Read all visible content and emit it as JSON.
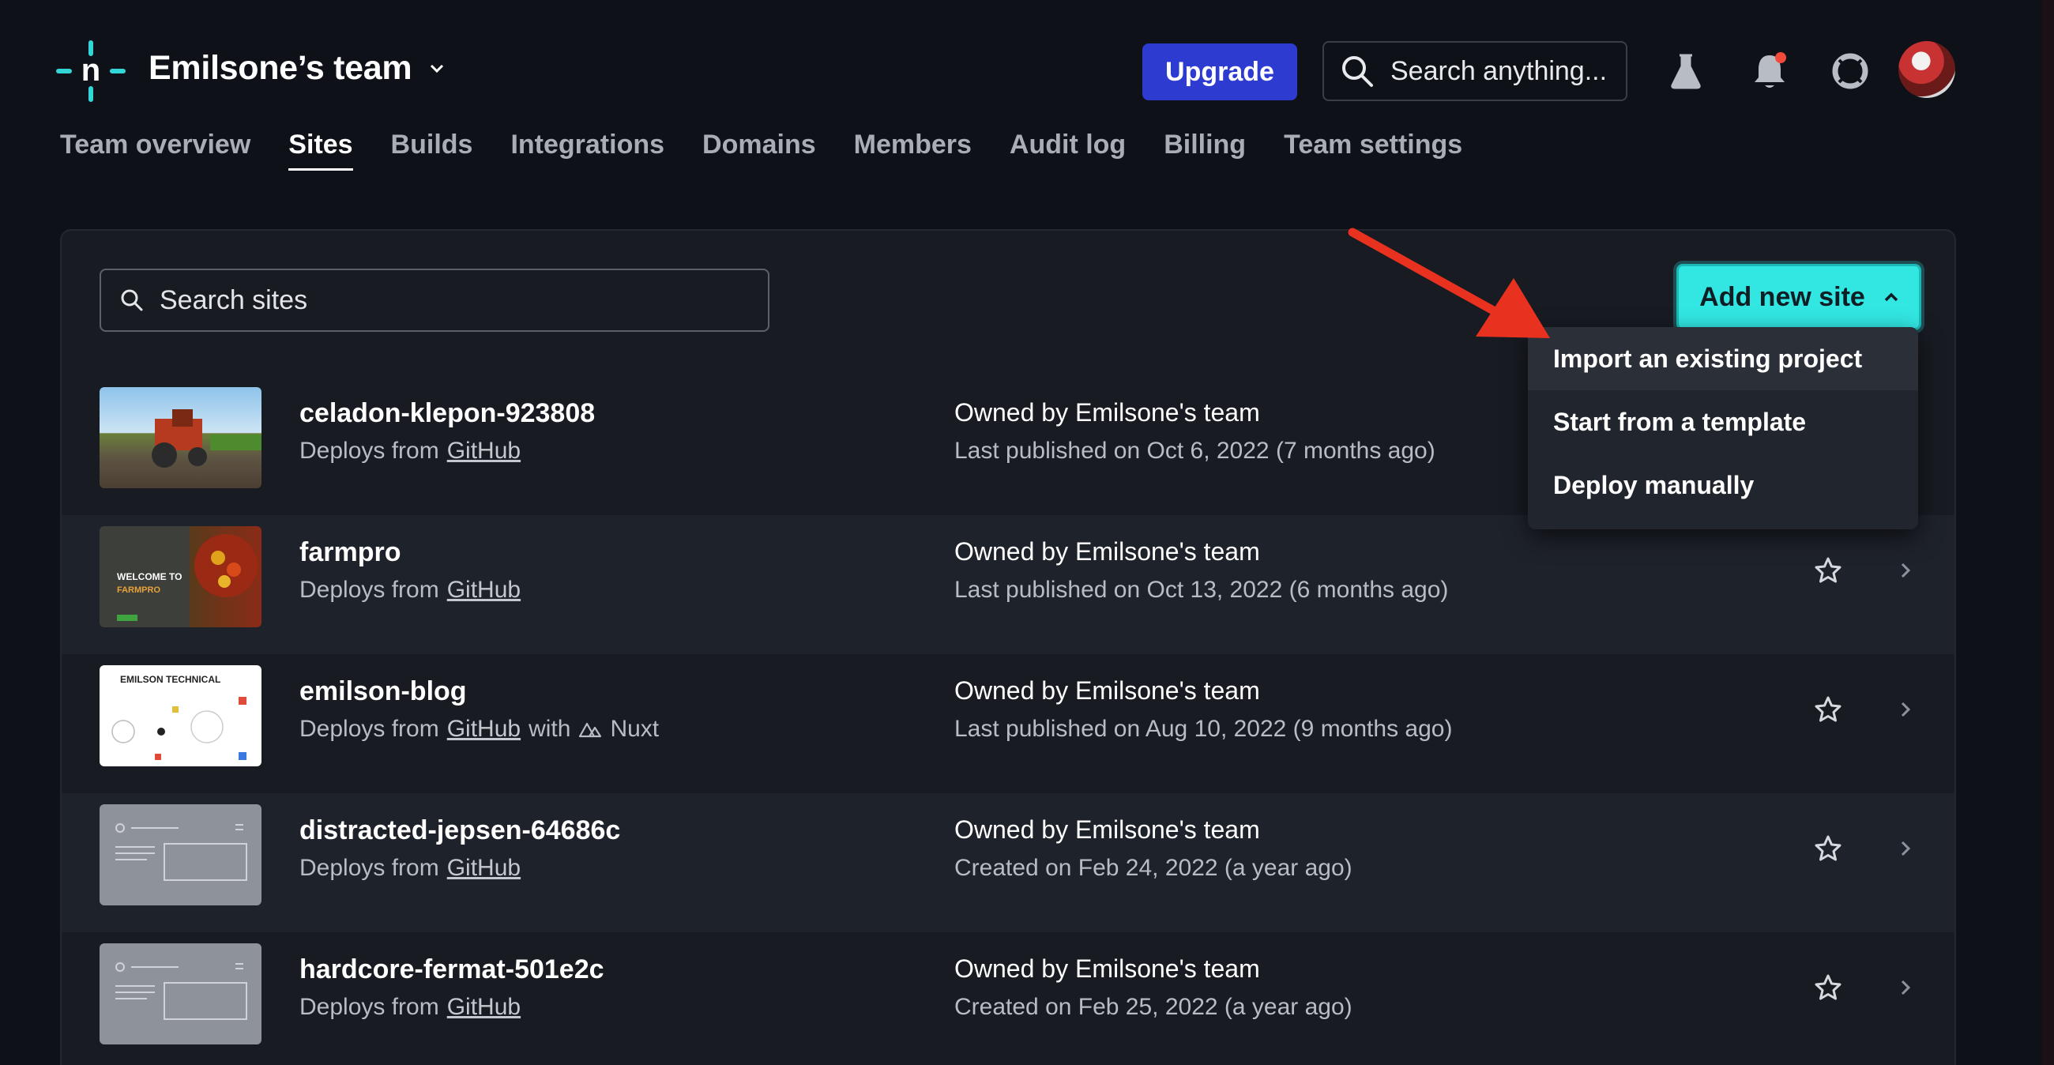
{
  "header": {
    "team_name": "Emilsone’s team",
    "upgrade_label": "Upgrade",
    "search_placeholder": "Search anything..."
  },
  "nav": {
    "items": [
      {
        "label": "Team overview"
      },
      {
        "label": "Sites"
      },
      {
        "label": "Builds"
      },
      {
        "label": "Integrations"
      },
      {
        "label": "Domains"
      },
      {
        "label": "Members"
      },
      {
        "label": "Audit log"
      },
      {
        "label": "Billing"
      },
      {
        "label": "Team settings"
      }
    ],
    "active": "Sites"
  },
  "toolbar": {
    "search_sites_placeholder": "Search sites",
    "add_new_site_label": "Add new site"
  },
  "dropdown": {
    "items": [
      {
        "label": "Import an existing project"
      },
      {
        "label": "Start from a template"
      },
      {
        "label": "Deploy manually"
      }
    ]
  },
  "sites": [
    {
      "name": "celadon-klepon-923808",
      "deploys_from": "Deploys from",
      "provider": "GitHub",
      "owner": "Owned by Emilsone's team",
      "date": "Last published on Oct 6, 2022 (7 months ago)"
    },
    {
      "name": "farmpro",
      "deploys_from": "Deploys from",
      "provider": "GitHub",
      "owner": "Owned by Emilsone's team",
      "date": "Last published on Oct 13, 2022 (6 months ago)"
    },
    {
      "name": "emilson-blog",
      "deploys_from": "Deploys from",
      "provider": "GitHub",
      "with_text": "with",
      "framework": "Nuxt",
      "owner": "Owned by Emilsone's team",
      "date": "Last published on Aug 10, 2022 (9 months ago)"
    },
    {
      "name": "distracted-jepsen-64686c",
      "deploys_from": "Deploys from",
      "provider": "GitHub",
      "owner": "Owned by Emilsone's team",
      "date": "Created on Feb 24, 2022 (a year ago)"
    },
    {
      "name": "hardcore-fermat-501e2c",
      "deploys_from": "Deploys from",
      "provider": "GitHub",
      "owner": "Owned by Emilsone's team",
      "date": "Created on Feb 25, 2022 (a year ago)"
    }
  ],
  "thumbnails": {
    "farmpro_heading": "WELCOME TO",
    "farmpro_brand": "FARMPRO",
    "blog_title": "EMILSON TECHNICAL"
  },
  "colors": {
    "accent_teal": "#32e6e2",
    "upgrade_blue": "#2d3bd1",
    "annotation_red": "#e8321f"
  }
}
